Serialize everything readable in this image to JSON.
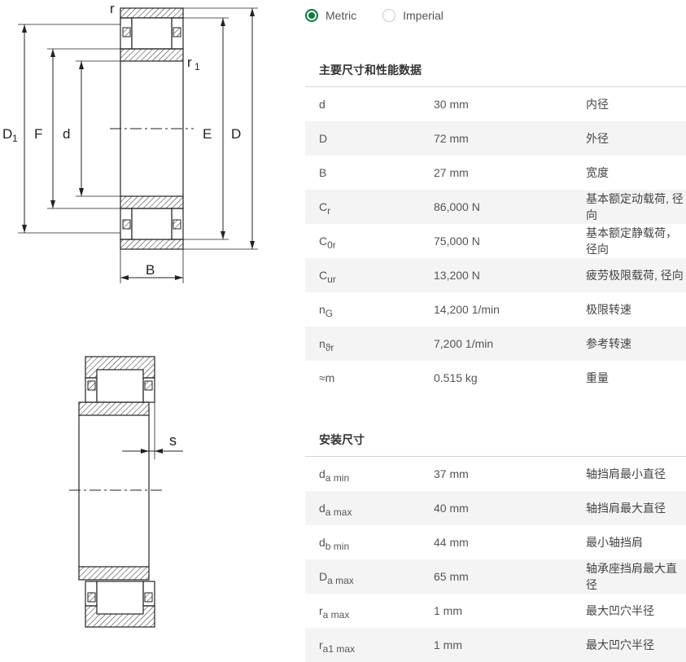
{
  "units": {
    "options": [
      {
        "label": "Metric",
        "selected": true
      },
      {
        "label": "Imperial",
        "selected": false
      }
    ]
  },
  "drawing_labels": {
    "top": [
      "r",
      "r",
      "1",
      "D",
      "1",
      "F",
      "d",
      "E",
      "D",
      "B"
    ],
    "bottom": [
      "s"
    ]
  },
  "sections": [
    {
      "title": "主要尺寸和性能数据",
      "rows": [
        {
          "sym": "d",
          "sub": "",
          "value": "30 mm",
          "desc": "内径"
        },
        {
          "sym": "D",
          "sub": "",
          "value": "72 mm",
          "desc": "外径"
        },
        {
          "sym": "B",
          "sub": "",
          "value": "27 mm",
          "desc": "宽度"
        },
        {
          "sym": "C",
          "sub": "r",
          "value": "86,000 N",
          "desc": "基本额定动载荷, 径向"
        },
        {
          "sym": "C",
          "sub": "0r",
          "value": "75,000 N",
          "desc": "基本额定静载荷，径向"
        },
        {
          "sym": "C",
          "sub": "ur",
          "value": "13,200 N",
          "desc": "疲劳极限载荷, 径向"
        },
        {
          "sym": "n",
          "sub": "G",
          "value": "14,200 1/min",
          "desc": "极限转速"
        },
        {
          "sym": "n",
          "sub": "ϑr",
          "value": "7,200 1/min",
          "desc": "参考转速"
        },
        {
          "sym": "≈m",
          "sub": "",
          "value": "0.515 kg",
          "desc": "重量"
        }
      ]
    },
    {
      "title": "安装尺寸",
      "rows": [
        {
          "sym": "d",
          "sub": "a min",
          "value": "37 mm",
          "desc": "轴挡肩最小直径"
        },
        {
          "sym": "d",
          "sub": "a max",
          "value": "40 mm",
          "desc": "轴挡肩最大直径"
        },
        {
          "sym": "d",
          "sub": "b min",
          "value": "44 mm",
          "desc": "最小轴挡肩"
        },
        {
          "sym": "D",
          "sub": "a max",
          "value": "65 mm",
          "desc": "轴承座挡肩最大直径"
        },
        {
          "sym": "r",
          "sub": "a max",
          "value": "1 mm",
          "desc": "最大凹穴半径"
        },
        {
          "sym": "r",
          "sub": "a1 max",
          "value": "1 mm",
          "desc": "最大凹穴半径"
        }
      ]
    }
  ],
  "colors": {
    "accent": "#0d7a3e",
    "stripe": "#f4f4f4",
    "rule": "#d6d6d6"
  }
}
